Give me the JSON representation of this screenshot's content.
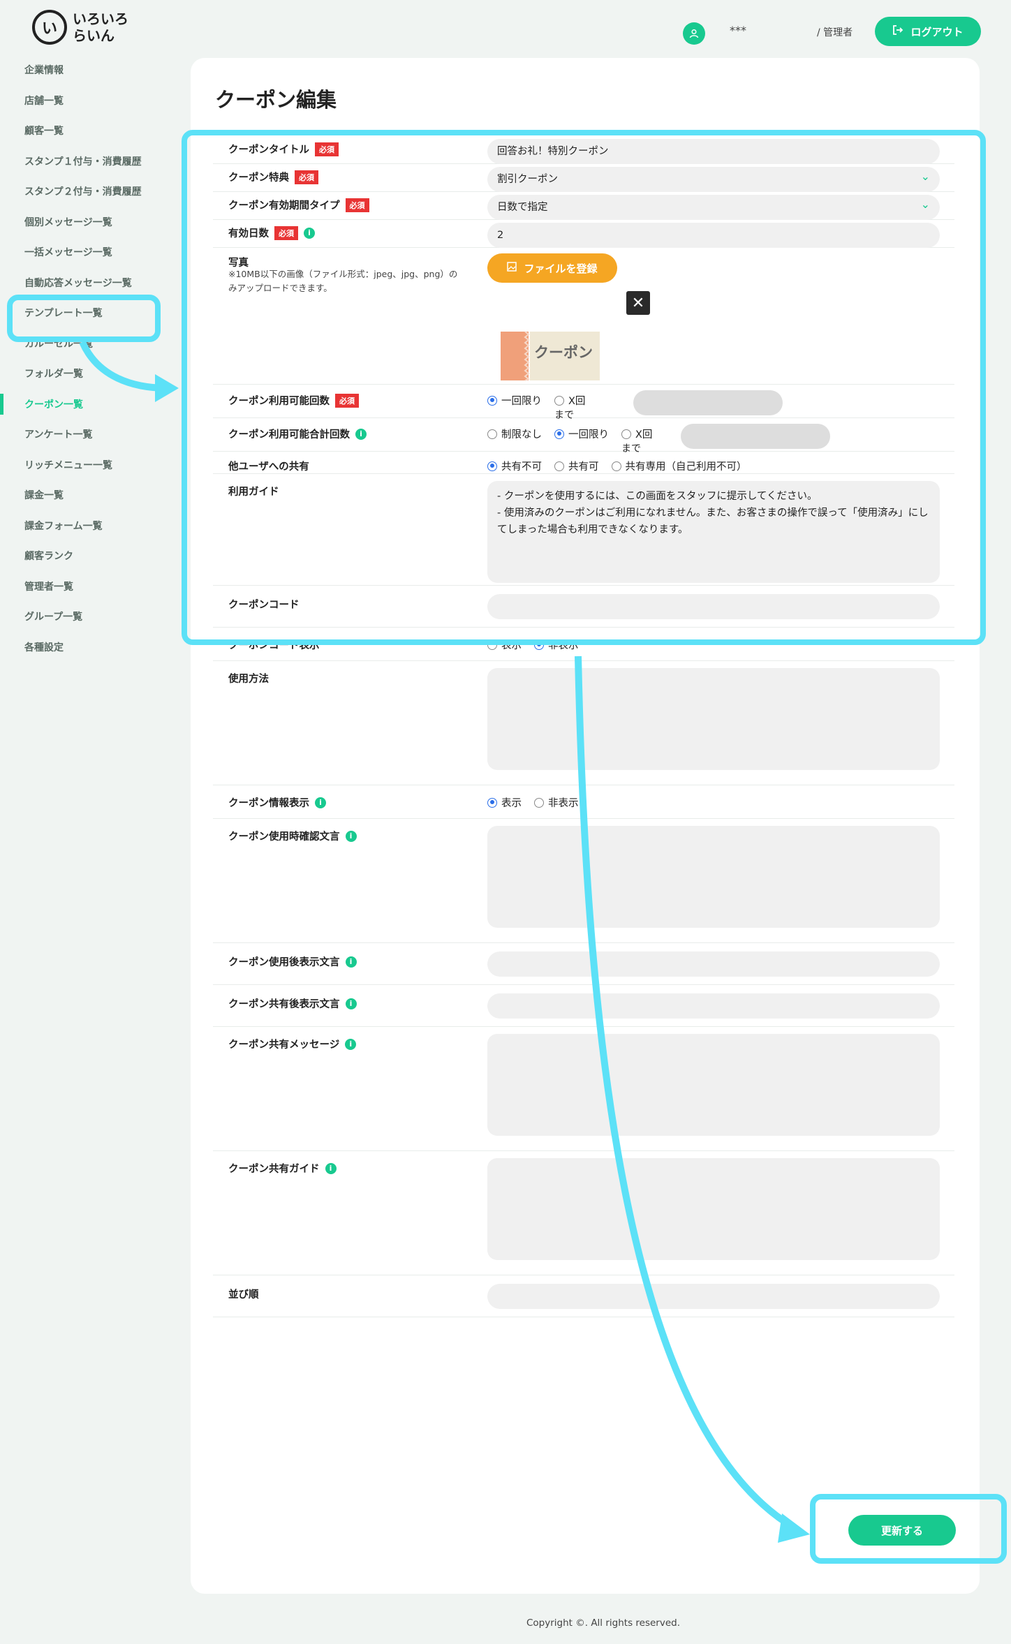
{
  "brand": {
    "mark": "い",
    "name": "いろいろ\nらいん"
  },
  "sidebar": {
    "items": [
      {
        "label": "企業情報"
      },
      {
        "label": "店舗一覧"
      },
      {
        "label": "顧客一覧"
      },
      {
        "label": "スタンプ１付与・消費履歴"
      },
      {
        "label": "スタンプ２付与・消費履歴"
      },
      {
        "label": "個別メッセージ一覧"
      },
      {
        "label": "一括メッセージ一覧"
      },
      {
        "label": "自動応答メッセージ一覧"
      },
      {
        "label": "テンプレート一覧"
      },
      {
        "label": "カルーセル一覧"
      },
      {
        "label": "フォルダ一覧"
      },
      {
        "label": "クーポン一覧"
      },
      {
        "label": "アンケート一覧"
      },
      {
        "label": "リッチメニュー一覧"
      },
      {
        "label": "課金一覧"
      },
      {
        "label": "課金フォーム一覧"
      },
      {
        "label": "顧客ランク"
      },
      {
        "label": "管理者一覧"
      },
      {
        "label": "グループ一覧"
      },
      {
        "label": "各種設定"
      }
    ],
    "active": "クーポン一覧"
  },
  "header": {
    "user_name": "***",
    "user_role": "/ 管理者",
    "logout_label": "ログアウト"
  },
  "page": {
    "title": "クーポン編集"
  },
  "form": {
    "required_badge": "必須",
    "title": {
      "label": "クーポンタイトル",
      "value": "回答お礼！特別クーポン"
    },
    "benefit": {
      "label": "クーポン特典",
      "value": "割引クーポン"
    },
    "period_type": {
      "label": "クーポン有効期間タイプ",
      "value": "日数で指定"
    },
    "valid_days": {
      "label": "有効日数",
      "value": "2"
    },
    "photo": {
      "label": "写真",
      "note": "※10MB以下の画像（ファイル形式：jpeg、jpg、png）のみアップロードできます。",
      "button": "ファイルを登録",
      "image_text": "クーポン"
    },
    "usage_count": {
      "label": "クーポン利用可能回数",
      "opt_once": "一回限り",
      "opt_x": "X回",
      "until": "まで",
      "selected": "一回限り"
    },
    "total_count": {
      "label": "クーポン利用可能合計回数",
      "opt_unlimited": "制限なし",
      "opt_once": "一回限り",
      "opt_x": "X回",
      "until": "まで",
      "selected": "一回限り"
    },
    "share": {
      "label": "他ユーザへの共有",
      "opt_no": "共有不可",
      "opt_yes": "共有可",
      "opt_only": "共有専用（自己利用不可）",
      "selected": "共有不可"
    },
    "guide": {
      "label": "利用ガイド",
      "value": "- クーポンを使用するには、この画面をスタッフに提示してください。\n- 使用済みのクーポンはご利用になれません。また、お客さまの操作で誤って「使用済み」にしてしまった場合も利用できなくなります。"
    },
    "code": {
      "label": "クーポンコード",
      "value": ""
    },
    "code_display": {
      "label": "クーポンコード表示",
      "opt_show": "表示",
      "opt_hide": "非表示",
      "selected": "非表示"
    },
    "usage_method": {
      "label": "使用方法",
      "value": ""
    },
    "info_display": {
      "label": "クーポン情報表示",
      "opt_show": "表示",
      "opt_hide": "非表示",
      "selected": "表示"
    },
    "confirm_text": {
      "label": "クーポン使用時確認文言",
      "value": ""
    },
    "after_use_text": {
      "label": "クーポン使用後表示文言",
      "value": ""
    },
    "after_share_text": {
      "label": "クーポン共有後表示文言",
      "value": ""
    },
    "share_message": {
      "label": "クーポン共有メッセージ",
      "value": ""
    },
    "share_guide": {
      "label": "クーポン共有ガイド",
      "value": ""
    },
    "sort_order": {
      "label": "並び順",
      "value": ""
    },
    "submit_label": "更新する"
  },
  "footer": {
    "copyright": "Copyright ©. All rights reserved."
  },
  "colors": {
    "accent": "#18c98f",
    "required": "#e83434",
    "file_button": "#f5a623",
    "annotation": "#5ce1f7"
  }
}
